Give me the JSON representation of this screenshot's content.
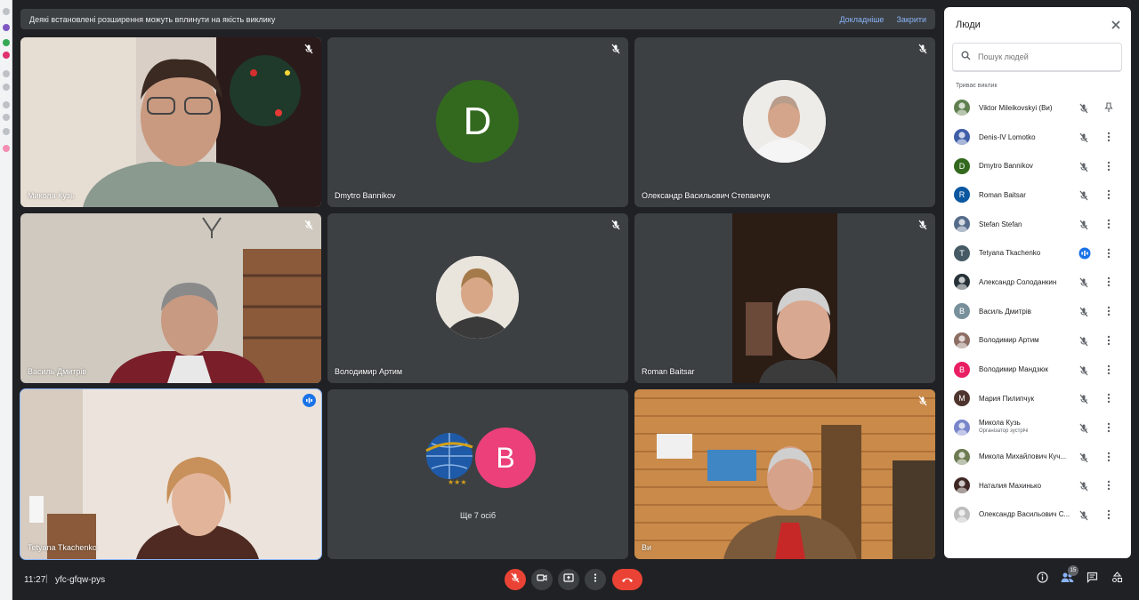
{
  "banner": {
    "text": "Деякі встановлені розширення можуть вплинути на якість виклику",
    "learn_more": "Докладніше",
    "dismiss": "Закрити"
  },
  "tiles": [
    {
      "name": "Микола Кузь",
      "kind": "video",
      "muted": true
    },
    {
      "name": "Dmytro Bannikov",
      "kind": "letter",
      "letter": "D",
      "color": "#33691e",
      "muted": true
    },
    {
      "name": "Олександр Васильович Степанчук",
      "kind": "photo",
      "muted": true
    },
    {
      "name": "Василь Дмитрів",
      "kind": "video",
      "muted": true
    },
    {
      "name": "Володимир Артим",
      "kind": "photo",
      "muted": true
    },
    {
      "name": "Roman Baitsar",
      "kind": "video",
      "muted": true
    },
    {
      "name": "Tetyana Tkachenko",
      "kind": "video",
      "speaking": true
    },
    {
      "name": "",
      "kind": "group",
      "letter": "B",
      "color": "#ec407a",
      "caption": "Ще 7 осіб"
    },
    {
      "name": "Ви",
      "kind": "video",
      "muted": true
    }
  ],
  "bottom": {
    "time": "11:27",
    "separator": "|",
    "meeting_code": "yfc-gfqw-pys",
    "participant_count": "15"
  },
  "people_panel": {
    "title": "Люди",
    "search_placeholder": "Пошук людей",
    "section_label": "Триває виклик",
    "people": [
      {
        "name": "Viktor Mileikovskyi (Ви)",
        "avatar": "photo",
        "color": "#5f7f4f",
        "status": "muted",
        "action": "pin-icon"
      },
      {
        "name": "Denis-IV Lomotko",
        "avatar": "logo",
        "color": "#3f5ea8",
        "status": "muted",
        "action": "more"
      },
      {
        "name": "Dmytro Bannikov",
        "avatar": "D",
        "color": "#33691e",
        "status": "muted",
        "action": "more"
      },
      {
        "name": "Roman Baitsar",
        "avatar": "R",
        "color": "#0b57a0",
        "status": "muted",
        "action": "more"
      },
      {
        "name": "Stefan Stefan",
        "avatar": "photo",
        "color": "#556b8a",
        "status": "muted",
        "action": "more"
      },
      {
        "name": "Tetyana Tkachenko",
        "avatar": "T",
        "color": "#455a64",
        "status": "speaking",
        "action": "more"
      },
      {
        "name": "Александр Солоданкин",
        "avatar": "photo",
        "color": "#263238",
        "status": "muted",
        "action": "more"
      },
      {
        "name": "Василь Дмитрів",
        "avatar": "B",
        "color": "#78909c",
        "status": "muted",
        "action": "more"
      },
      {
        "name": "Володимир Артим",
        "avatar": "photo",
        "color": "#8d6e63",
        "status": "muted",
        "action": "more"
      },
      {
        "name": "Володимир Мандзюк",
        "avatar": "B",
        "color": "#e91e63",
        "status": "muted",
        "action": "more"
      },
      {
        "name": "Мария Пилипчук",
        "avatar": "M",
        "color": "#4e342e",
        "status": "muted",
        "action": "more"
      },
      {
        "name": "Микола Кузь",
        "sub": "Організатор зустрічі",
        "avatar": "logo",
        "color": "#7986cb",
        "status": "muted",
        "action": "more"
      },
      {
        "name": "Микола Михайлович Куч...",
        "avatar": "photo",
        "color": "#6d7b52",
        "status": "muted",
        "action": "more"
      },
      {
        "name": "Наталия Махинько",
        "avatar": "photo",
        "color": "#3e2723",
        "status": "muted",
        "action": "more"
      },
      {
        "name": "Олександр Васильович С...",
        "avatar": "photo",
        "color": "#bdbdbd",
        "status": "muted",
        "action": "more"
      }
    ]
  }
}
